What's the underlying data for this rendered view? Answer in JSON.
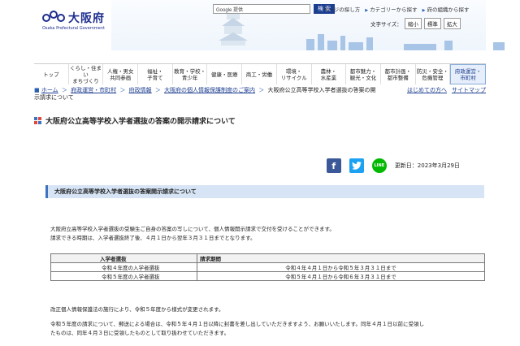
{
  "header": {
    "logo_text": "大阪府",
    "logo_sub": "Osaka Prefectural Government",
    "search_placeholder": "Google 提供",
    "search_button": "検 索",
    "top_links": [
      "ページの探し方",
      "カテゴリーから探す",
      "府の組織から探す"
    ],
    "font_size_label": "文字サイズ：",
    "font_size_buttons": [
      "縮小",
      "標準",
      "拡大"
    ]
  },
  "nav": [
    "トップ",
    "くらし・住まい まちづくり",
    "人権・男女 共同参画",
    "福祉・ 子育て",
    "教育・学校・ 青少年",
    "健康・医療",
    "商工・労働",
    "環境・ リサイクル",
    "農林・ 水産業",
    "都市魅力・ 観光・文化",
    "都市計画・ 都市整備",
    "防災・安全・ 危機管理",
    "府政運営・ 市町村"
  ],
  "breadcrumb": {
    "items": [
      "ホーム",
      "府政運営・市町村",
      "府政情報",
      "大阪府の個人情報保護制度のご案内",
      "大阪府公立高等学校入学者選抜の答案の開"
    ],
    "wrap": "示請求について",
    "right_links": [
      "はじめての方へ",
      "サイトマップ"
    ]
  },
  "page_title": "大阪府公立高等学校入学者選抜の答案の開示請求について",
  "social": {
    "facebook": "f",
    "twitter": "t",
    "line": "LINE"
  },
  "updated": "更新日：2023年3月29日",
  "section_heading": "大阪府公立高等学校入学者選抜の答案開示請求について",
  "intro_lines": [
    "大阪府立高等学校入学者選抜の受験生ご自身の答案の写しについて、個人情報開示請求で交付を受けることができます。",
    "請求できる時期は、入学者選抜終了後、４月１日から翌年３月３１日までとなります。"
  ],
  "table": {
    "headers": [
      "入学者選抜",
      "請求期間"
    ],
    "rows": [
      [
        "令和４年度の入学者選抜",
        "令和４年４月１日から令和５年３月３１日まで"
      ],
      [
        "令和５年度の入学者選抜",
        "令和５年４月１日から令和６年３月３１日まで"
      ]
    ]
  },
  "note1": "改正個人情報保護法の施行により、令和５年度から様式が変更されます。",
  "note2_lines": [
    "令和５年度の請求について、郵送による場合は、令和５年４月１日以降に封書を差し出していただきますよう、お願いいたします。同年４月１日以前に受領し",
    "たものは、同年４月３日に受領したものとして取り扱わせていただきます。"
  ]
}
